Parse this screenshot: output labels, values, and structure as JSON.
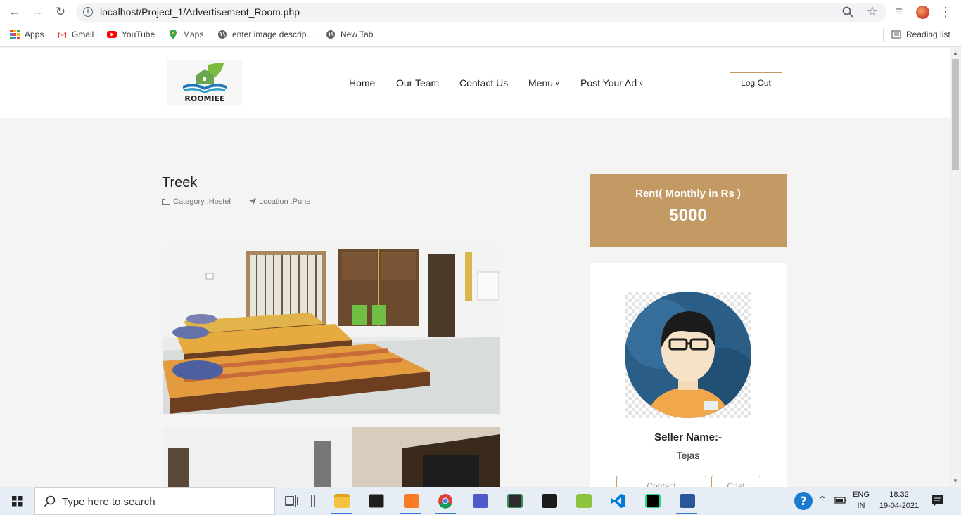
{
  "browser": {
    "url": "localhost/Project_1/Advertisement_Room.php",
    "bookmarks": [
      {
        "label": "Apps",
        "icon": "apps-grid-icon"
      },
      {
        "label": "Gmail",
        "icon": "gmail-icon"
      },
      {
        "label": "YouTube",
        "icon": "youtube-icon"
      },
      {
        "label": "Maps",
        "icon": "maps-icon"
      },
      {
        "label": "enter image descrip...",
        "icon": "globe-icon"
      },
      {
        "label": "New Tab",
        "icon": "globe-icon"
      }
    ],
    "reading_list": "Reading list"
  },
  "site": {
    "logo_text": "ROOMIEE",
    "nav": {
      "home": "Home",
      "team": "Our Team",
      "contact": "Contact Us",
      "menu": "Menu",
      "post_ad": "Post Your Ad"
    },
    "logout": "Log Out",
    "accent_color": "#c49a64"
  },
  "ad": {
    "title": "Treek",
    "category": "Category :Hostel",
    "location": "Location :Pune",
    "rent_label": "Rent( Monthly in Rs )",
    "rent_value": "5000"
  },
  "seller": {
    "name_label": "Seller Name:-",
    "name": "Tejas",
    "contact_button": "Contact",
    "chat_button": "Chat"
  },
  "taskbar": {
    "search_placeholder": "Type here to search",
    "lang_top": "ENG",
    "lang_bottom": "IN",
    "time": "18:32",
    "date": "19-04-2021"
  }
}
